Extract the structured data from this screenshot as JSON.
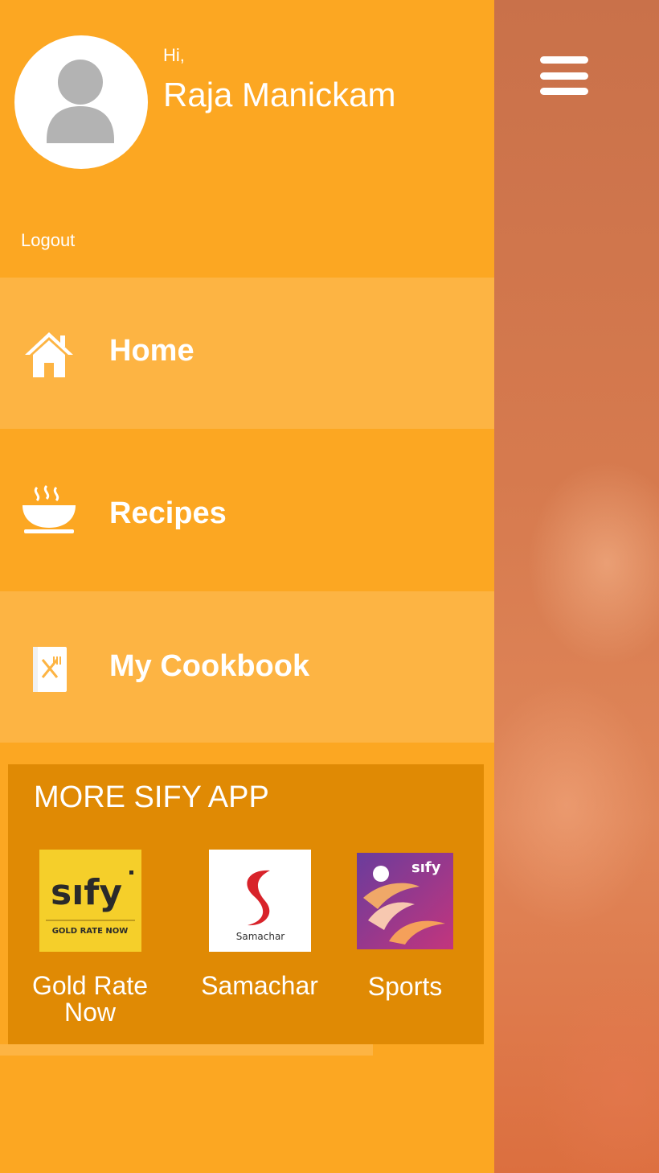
{
  "header": {
    "greeting": "Hi,",
    "user_name": "Raja Manickam",
    "logout_label": "Logout"
  },
  "nav": {
    "items": [
      {
        "label": "Home",
        "icon": "home-icon"
      },
      {
        "label": "Recipes",
        "icon": "soup-bowl-icon"
      },
      {
        "label": "My Cookbook",
        "icon": "cookbook-icon"
      }
    ]
  },
  "more_apps": {
    "title": "MORE SIFY APP",
    "apps": [
      {
        "name": "Gold Rate Now",
        "logo_text": "sıfy",
        "logo_caption": "GOLD RATE NOW"
      },
      {
        "name": "Samachar",
        "logo_caption": "Samachar"
      },
      {
        "name": "Sports",
        "logo_text": "sıfy"
      }
    ]
  },
  "colors": {
    "drawer": "#fca722",
    "drawer_light": "#fdb443",
    "more_box": "#e08a04",
    "text": "#ffffff"
  }
}
